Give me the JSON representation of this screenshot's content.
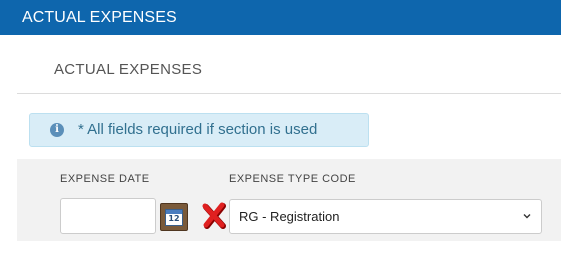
{
  "header": {
    "title": "ACTUAL EXPENSES"
  },
  "section": {
    "title": "ACTUAL EXPENSES"
  },
  "notice": {
    "icon": "info-icon",
    "text": "* All fields required if section is used"
  },
  "form": {
    "expense_date": {
      "label": "EXPENSE DATE",
      "value": "",
      "button_icon": "calendar-icon"
    },
    "expense_type": {
      "label": "EXPENSE TYPE CODE",
      "selected": "RG - Registration",
      "status_icon": "error-x-icon"
    }
  },
  "colors": {
    "header_bg": "#0e66ad",
    "notice_bg": "#d9edf7",
    "notice_text": "#31708f",
    "error": "#e02020"
  }
}
